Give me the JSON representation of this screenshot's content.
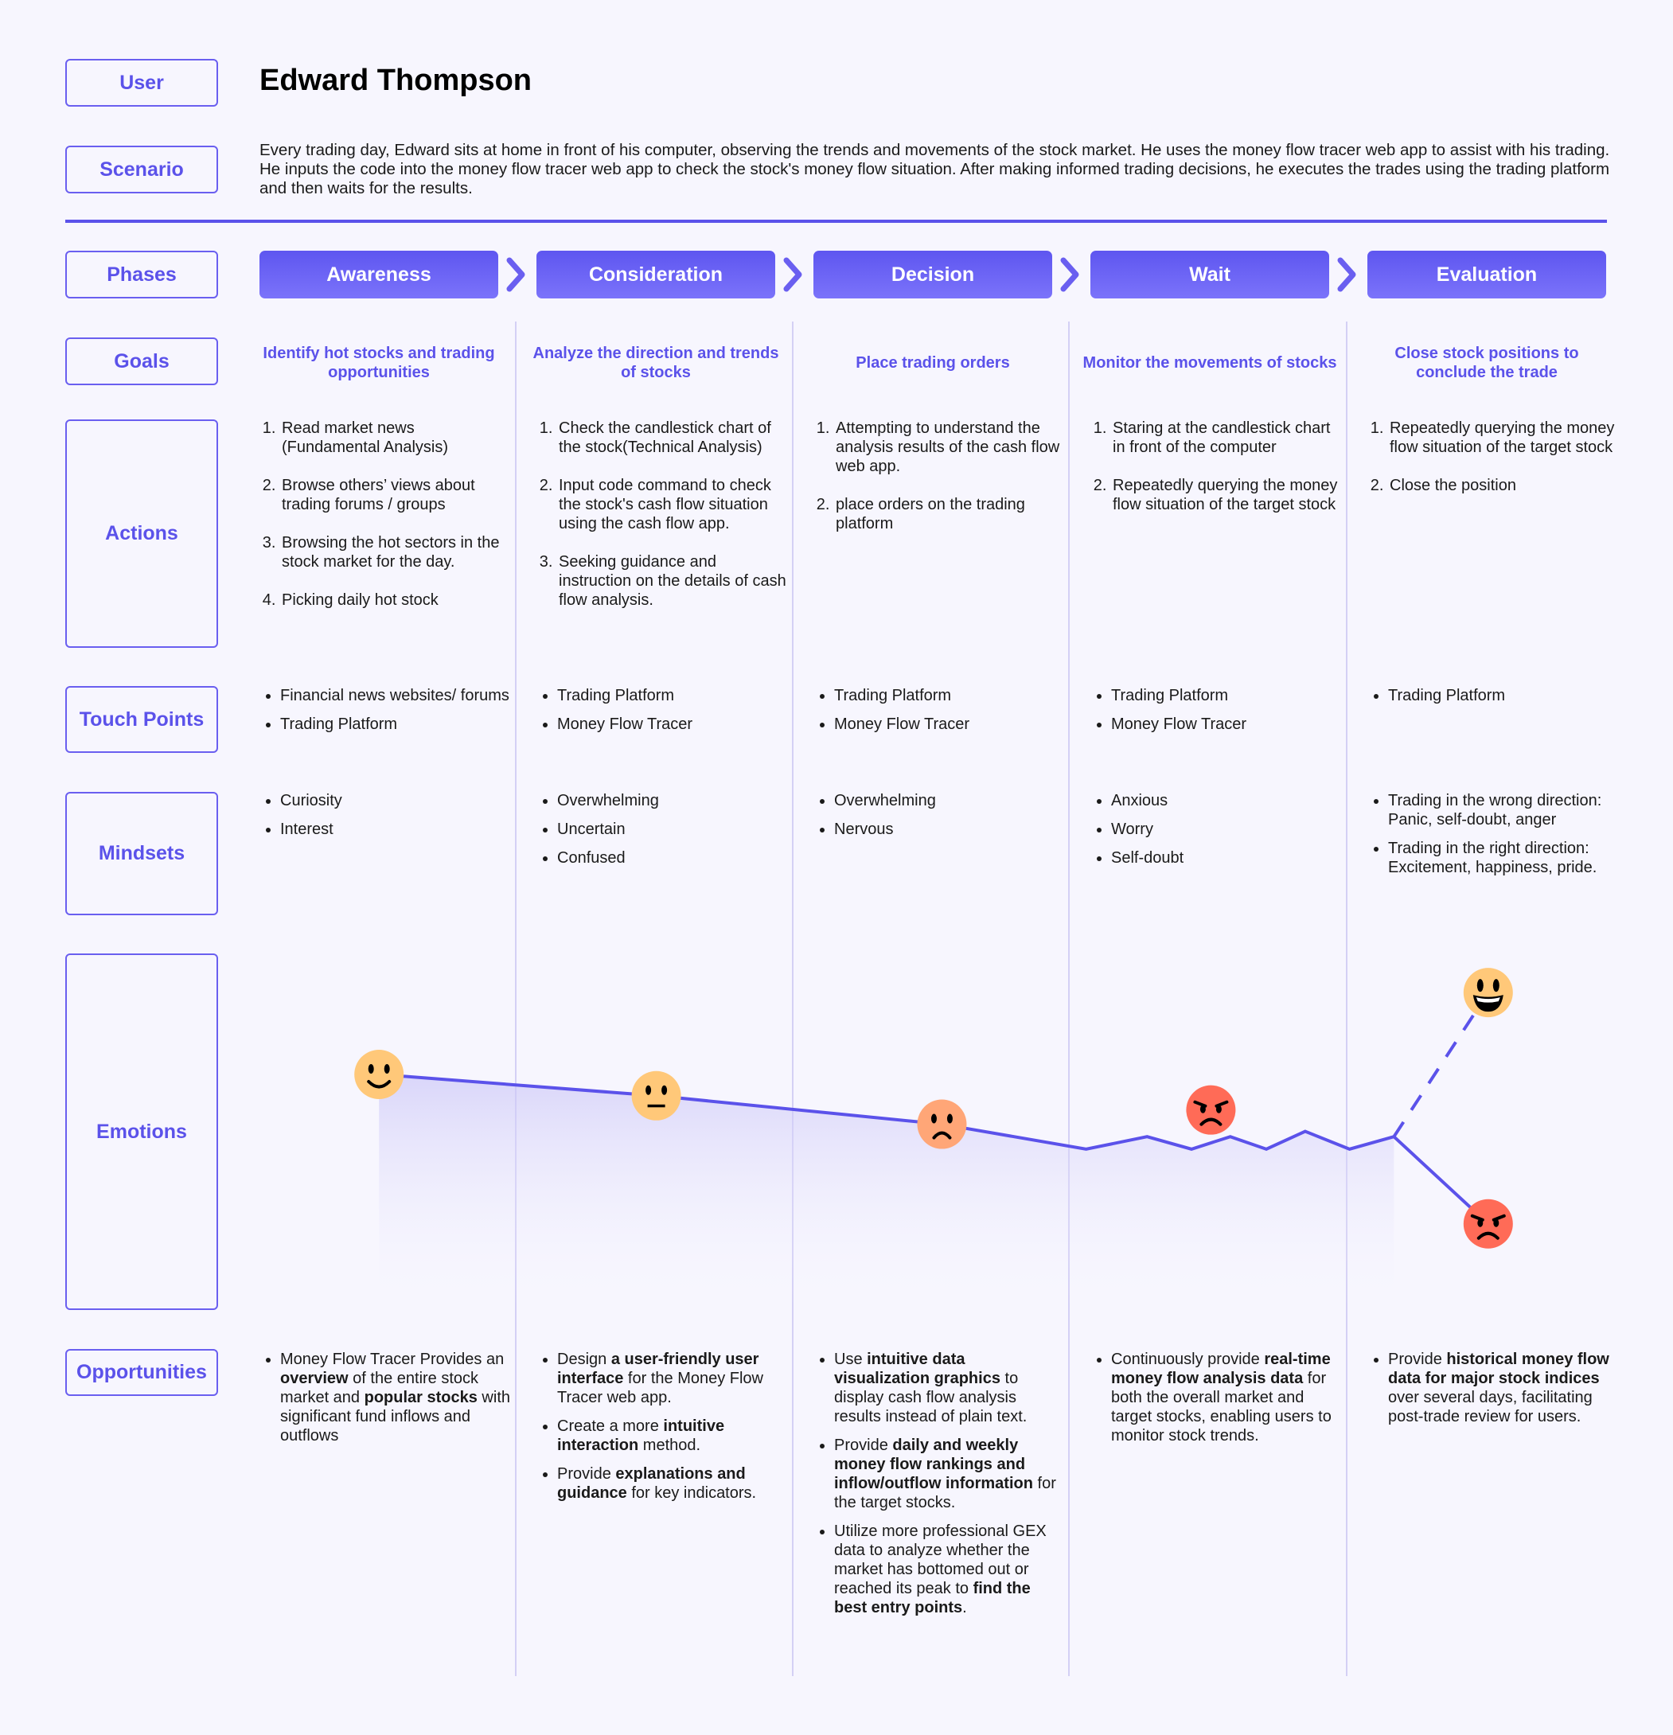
{
  "user": {
    "label": "User",
    "name": "Edward Thompson"
  },
  "scenario": {
    "label": "Scenario",
    "text": "Every trading day, Edward sits at home in front of his computer, observing the trends and movements of the stock market. He uses the money flow tracer web app to assist with his trading. He inputs the code into the money flow tracer web app to check the stock's money flow situation. After making informed trading decisions, he executes the trades using the trading platform and then waits for the results."
  },
  "row_labels": {
    "phases": "Phases",
    "goals": "Goals",
    "actions": "Actions",
    "touch_points": "Touch Points",
    "mindsets": "Mindsets",
    "emotions": "Emotions",
    "opportunities": "Opportunities"
  },
  "colors": {
    "accent": "#5b52ea",
    "background": "#f7f6fe",
    "separator": "#d4d0f5",
    "face_happy": "#ffc879",
    "face_sad": "#ffa677",
    "face_angry": "#ff6b57"
  },
  "phases": [
    {
      "name": "Awareness",
      "goal": "Identify hot stocks and trading opportunities",
      "actions": [
        "Read market news (Fundamental Analysis)",
        "Browse others’ views about trading forums / groups",
        "Browsing the hot sectors in the stock market for the day.",
        "Picking daily hot stock"
      ],
      "touch_points": [
        "Financial news websites/ forums",
        "Trading Platform"
      ],
      "mindsets": [
        "Curiosity",
        "Interest"
      ],
      "opportunities": [
        [
          {
            "t": "Money Flow Tracer Provides an ",
            "b": false
          },
          {
            "t": "overview",
            "b": true
          },
          {
            "t": " of the entire stock market and ",
            "b": false
          },
          {
            "t": "popular stocks",
            "b": true
          },
          {
            "t": " with significant fund inflows and outflows",
            "b": false
          }
        ]
      ]
    },
    {
      "name": "Consideration",
      "goal": "Analyze the direction and trends of stocks",
      "actions": [
        "Check the candlestick chart of the stock(Technical Analysis)",
        "Input code command to check the stock's cash flow situation using the cash flow app.",
        "Seeking guidance and instruction on the details of cash flow analysis."
      ],
      "touch_points": [
        "Trading Platform",
        "Money Flow Tracer"
      ],
      "mindsets": [
        "Overwhelming",
        "Uncertain",
        "Confused"
      ],
      "opportunities": [
        [
          {
            "t": "Design ",
            "b": false
          },
          {
            "t": "a user-friendly user interface",
            "b": true
          },
          {
            "t": " for the Money Flow Tracer web app.",
            "b": false
          }
        ],
        [
          {
            "t": "Create a more ",
            "b": false
          },
          {
            "t": "intuitive interaction",
            "b": true
          },
          {
            "t": " method.",
            "b": false
          }
        ],
        [
          {
            "t": "Provide ",
            "b": false
          },
          {
            "t": "explanations and guidance",
            "b": true
          },
          {
            "t": " for key indicators.",
            "b": false
          }
        ]
      ]
    },
    {
      "name": "Decision",
      "goal": "Place trading orders",
      "actions": [
        "Attempting to understand the analysis results of the cash flow web app.",
        "place orders on the trading platform"
      ],
      "touch_points": [
        "Trading Platform",
        "Money Flow Tracer"
      ],
      "mindsets": [
        "Overwhelming",
        "Nervous"
      ],
      "opportunities": [
        [
          {
            "t": "Use ",
            "b": false
          },
          {
            "t": "intuitive data visualization graphics",
            "b": true
          },
          {
            "t": " to display cash flow analysis results instead of plain text.",
            "b": false
          }
        ],
        [
          {
            "t": "Provide ",
            "b": false
          },
          {
            "t": "daily and weekly money flow rankings and inflow/outflow information",
            "b": true
          },
          {
            "t": " for the target stocks.",
            "b": false
          }
        ],
        [
          {
            "t": "Utilize more professional GEX data to analyze whether the market has bottomed out or reached its peak to ",
            "b": false
          },
          {
            "t": "find the best entry points",
            "b": true
          },
          {
            "t": ".",
            "b": false
          }
        ]
      ]
    },
    {
      "name": "Wait",
      "goal": "Monitor the movements of stocks",
      "actions": [
        "Staring at the candlestick chart in front of the computer",
        "Repeatedly querying the money flow situation of the target stock"
      ],
      "touch_points": [
        "Trading Platform",
        "Money Flow Tracer"
      ],
      "mindsets": [
        "Anxious",
        "Worry",
        "Self-doubt"
      ],
      "opportunities": [
        [
          {
            "t": "Continuously provide ",
            "b": false
          },
          {
            "t": "real-time money flow analysis data",
            "b": true
          },
          {
            "t": " for both the overall market and target stocks, enabling users to monitor stock trends.",
            "b": false
          }
        ]
      ]
    },
    {
      "name": "Evaluation",
      "goal": "Close stock positions to conclude the trade",
      "actions": [
        "Repeatedly querying the money flow situation of the target stock",
        "Close the position"
      ],
      "touch_points": [
        "Trading Platform"
      ],
      "mindsets": [
        "Trading in the wrong direction: Panic, self-doubt, anger",
        "Trading in the right direction: Excitement, happiness, pride."
      ],
      "opportunities": [
        [
          {
            "t": "Provide ",
            "b": false
          },
          {
            "t": "historical money flow data for major stock indices",
            "b": true
          },
          {
            "t": " over several days, facilitating post-trade review for users.",
            "b": false
          }
        ]
      ]
    }
  ],
  "chart_data": {
    "type": "line",
    "title": "Emotions",
    "xlabel": "",
    "ylabel": "",
    "categories": [
      "Awareness",
      "Consideration",
      "Decision",
      "Wait",
      "Evaluation"
    ],
    "x_range": [
      0,
      5
    ],
    "ylim": [
      0,
      10
    ],
    "grid": false,
    "series": [
      {
        "name": "emotion-curve",
        "style": "solid",
        "fill_below": true,
        "points": [
          {
            "x": 0.5,
            "y": 6.6,
            "face": "slightly-smiling"
          },
          {
            "x": 1.5,
            "y": 6.0,
            "face": "neutral"
          },
          {
            "x": 2.53,
            "y": 5.2,
            "face": "frowning"
          },
          {
            "x": 3.05,
            "y": 4.5
          },
          {
            "x": 3.27,
            "y": 4.85
          },
          {
            "x": 3.43,
            "y": 4.5
          },
          {
            "x": 3.57,
            "y": 4.85
          },
          {
            "x": 3.7,
            "y": 4.5
          },
          {
            "x": 3.84,
            "y": 5.0
          },
          {
            "x": 4.0,
            "y": 4.5
          },
          {
            "x": 4.16,
            "y": 4.85
          }
        ],
        "annotations": [
          {
            "x": 3.5,
            "y": 5.6,
            "face": "angry"
          }
        ]
      },
      {
        "name": "wrong-direction",
        "style": "solid",
        "points": [
          {
            "x": 4.16,
            "y": 4.85
          },
          {
            "x": 4.5,
            "y": 2.4,
            "face": "angry"
          }
        ]
      },
      {
        "name": "right-direction",
        "style": "dashed",
        "points": [
          {
            "x": 4.16,
            "y": 4.85
          },
          {
            "x": 4.5,
            "y": 8.9,
            "face": "grinning"
          }
        ]
      }
    ]
  }
}
